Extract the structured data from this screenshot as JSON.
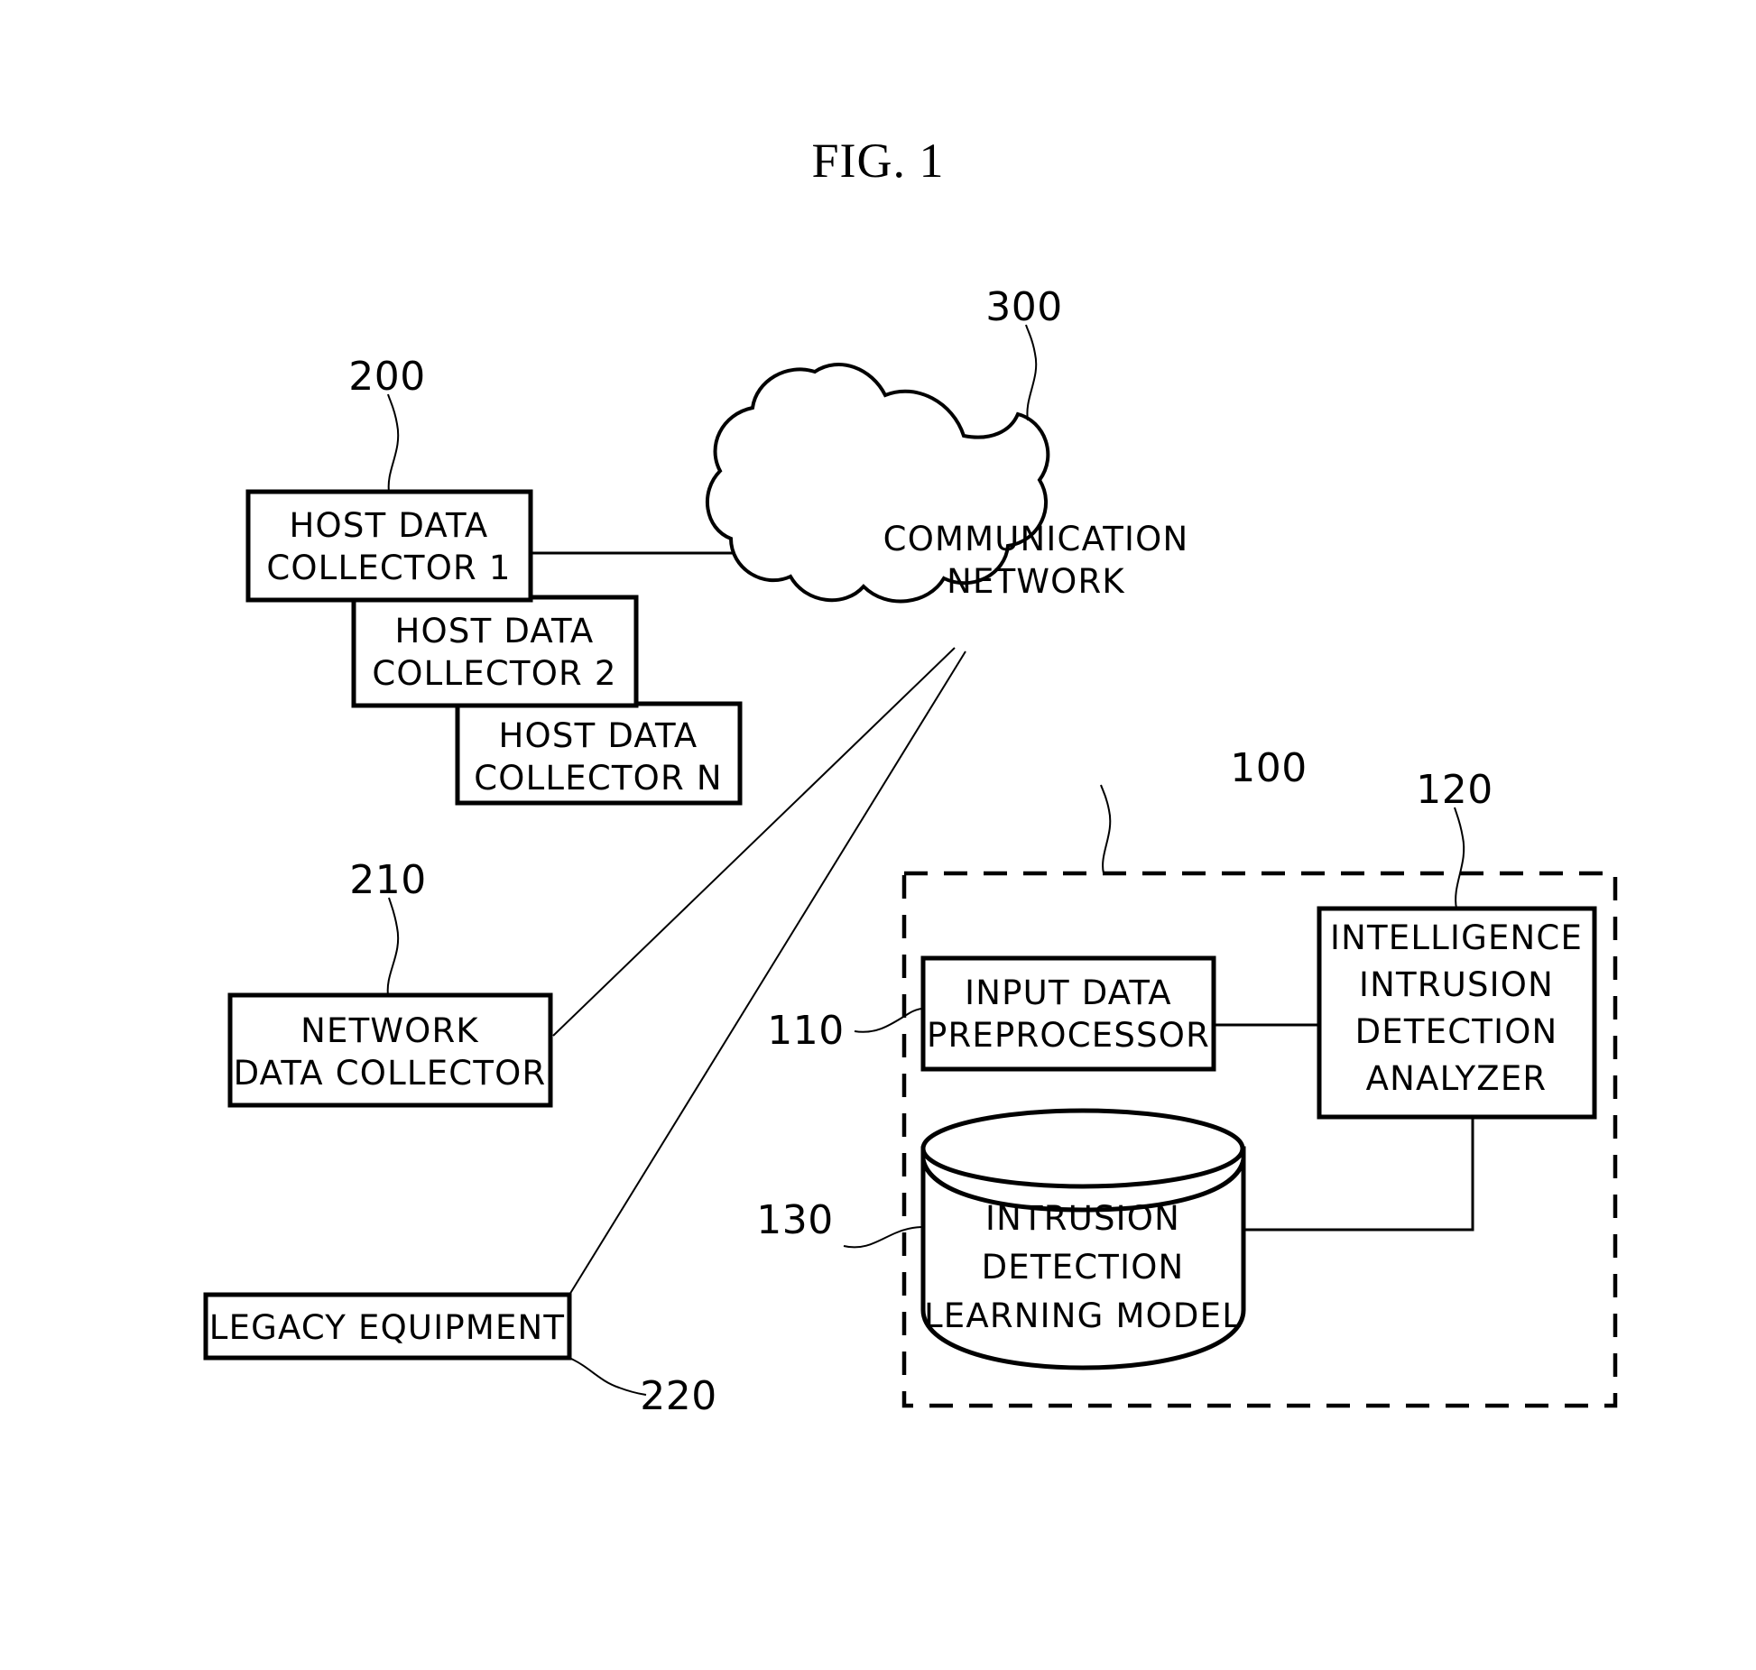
{
  "figure": {
    "title": "FIG. 1",
    "type": "patent-block-diagram"
  },
  "nodes": {
    "host_collector_1": {
      "ref": "200",
      "lines": [
        "HOST DATA",
        "COLLECTOR 1"
      ]
    },
    "host_collector_2": {
      "lines": [
        "HOST DATA",
        "COLLECTOR 2"
      ]
    },
    "host_collector_n": {
      "lines": [
        "HOST DATA",
        "COLLECTOR N"
      ]
    },
    "network_data_collector": {
      "ref": "210",
      "lines": [
        "NETWORK",
        "DATA COLLECTOR"
      ]
    },
    "legacy_equipment": {
      "ref": "220",
      "lines": [
        "LEGACY EQUIPMENT"
      ]
    },
    "communication_network": {
      "ref": "300",
      "lines": [
        "COMMUNICATION",
        "NETWORK"
      ]
    },
    "system_boundary": {
      "ref": "100"
    },
    "input_data_preprocessor": {
      "ref": "110",
      "lines": [
        "INPUT DATA",
        "PREPROCESSOR"
      ]
    },
    "intelligence_intrusion_detection_analyzer": {
      "ref": "120",
      "lines": [
        "INTELLIGENCE",
        "INTRUSION",
        "DETECTION",
        "ANALYZER"
      ]
    },
    "intrusion_detection_learning_model": {
      "ref": "130",
      "lines": [
        "INTRUSION",
        "DETECTION",
        "LEARNING MODEL"
      ]
    }
  },
  "colors": {
    "stroke": "#000000",
    "background": "#ffffff"
  }
}
